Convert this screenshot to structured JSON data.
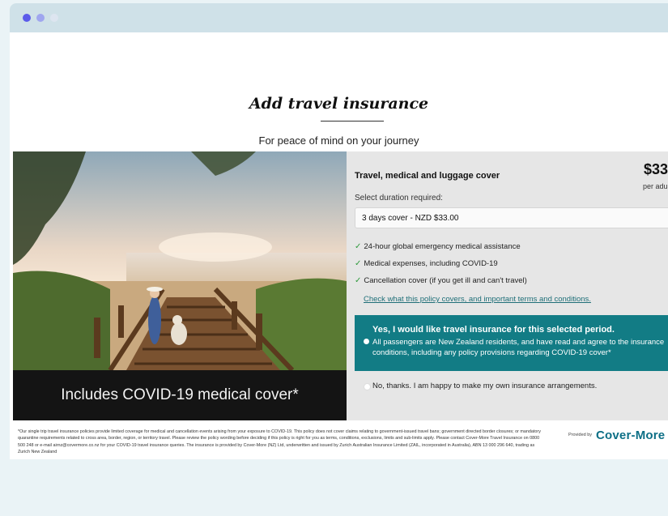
{
  "window": {
    "controls": [
      "close",
      "minimize",
      "maximize"
    ]
  },
  "header": {
    "title": "Add travel insurance",
    "subtitle": "For peace of mind on your journey"
  },
  "hero": {
    "caption": "Includes COVID-19 medical cover*"
  },
  "insurance": {
    "title": "Travel, medical and luggage cover",
    "price": "$33",
    "price_unit": "per adu",
    "duration_label": "Select duration required:",
    "duration_selected": "3 days cover - NZD $33.00",
    "features": [
      "24-hour global emergency medical assistance",
      "Medical expenses, including COVID-19",
      "Cancellation cover (if you get ill and can't travel)"
    ],
    "policy_link": "Check what this policy covers, and important terms and conditions.",
    "accept_title": "Yes, I would like travel insurance for this selected period.",
    "accept_text": "All passengers are New Zealand residents, and have read and agree to the insurance conditions, including any policy provisions regarding COVID-19 cover*",
    "decline_text": "No, thanks. I am happy to make my own insurance arrangements."
  },
  "footer": {
    "disclaimer": "*Our single trip travel insurance policies provide limited coverage for medical and cancellation events arising from your exposure to COVID-19. This policy does not cover claims relating to government-issued travel bans; government directed border closures; or mandatory quarantine requirements related to cross area, border, region, or territory travel. Please review the policy wording before deciding if this policy is right for you as terms, conditions, exclusions, limits and sub-limits apply. Please contact Cover-More Travel Insurance on 0800 500 248 or e-mail airnz@covermore.co.nz for your COVID-19 travel insurance queries. The insurance is provided by Cover-More (NZ) Ltd, underwritten and issued by Zurich Australian Insurance Limited (ZAIL, incorporated in Australia), ABN 13 000 296 640, trading as Zurich New Zealand",
    "provided_by": "Provided by",
    "logo_text": "Cover-More"
  },
  "colors": {
    "accent": "#127c85",
    "tick": "#2f9a3c",
    "link": "#1f6f78",
    "logo": "#0d6f86"
  }
}
